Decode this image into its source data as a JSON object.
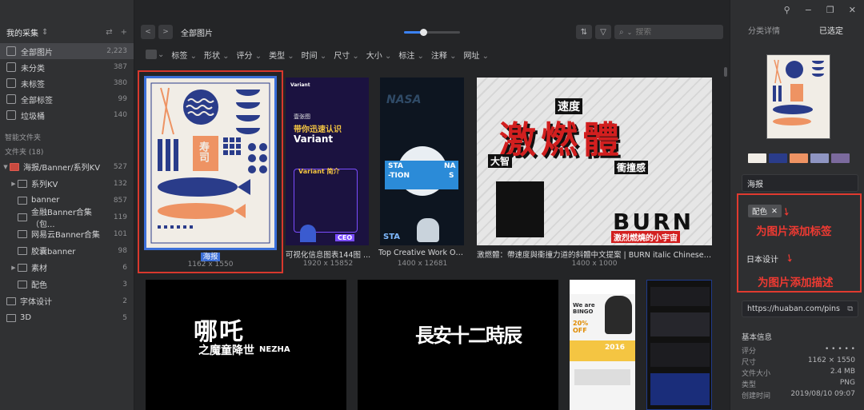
{
  "sidebar": {
    "library_label": "我的采集",
    "nav": [
      {
        "label": "全部图片",
        "count": "2,223"
      },
      {
        "label": "未分类",
        "count": "387"
      },
      {
        "label": "未标签",
        "count": "380"
      },
      {
        "label": "全部标签",
        "count": "99"
      },
      {
        "label": "垃圾桶",
        "count": "140"
      }
    ],
    "smart_folders_label": "智能文件夹",
    "folders_label": "文件夹 (18)",
    "folders": [
      {
        "label": "海报/Banner/系列KV",
        "count": "527"
      },
      {
        "label": "系列KV",
        "count": "132"
      },
      {
        "label": "banner",
        "count": "857"
      },
      {
        "label": "金融Banner合集（包...",
        "count": "119"
      },
      {
        "label": "网易云Banner合集",
        "count": "101"
      },
      {
        "label": "胶囊banner",
        "count": "98"
      },
      {
        "label": "素材",
        "count": "6"
      },
      {
        "label": "配色",
        "count": "3"
      },
      {
        "label": "字体设计",
        "count": "2"
      },
      {
        "label": "3D",
        "count": "5"
      }
    ]
  },
  "toolbar": {
    "breadcrumb": "全部图片",
    "search_placeholder": "搜索",
    "zoom_fraction": 0.35
  },
  "filters": [
    "标签",
    "形状",
    "评分",
    "类型",
    "时间",
    "尺寸",
    "大小",
    "标注",
    "注释",
    "网址"
  ],
  "grid": [
    {
      "caption": "海报",
      "dims": "1162 x 1550"
    },
    {
      "caption": "可视化信息图表144图 ...",
      "dims": "1920 x 15852"
    },
    {
      "caption": "Top Creative Work On...",
      "dims": "1400 x 12681"
    },
    {
      "caption": "激燃體：帶速度與衝撞力道的斜體中文提案 | BURN italic Chinese fon...",
      "dims": "1400 x 1000"
    }
  ],
  "thumb_text": {
    "variant_brand": "Variant",
    "variant_sub": "壹张图",
    "variant_h1": "带你迅速认识",
    "variant_h2": "Variant",
    "variant_h3": "Variant 简介",
    "variant_ceo": "CEO",
    "nasa": "NASA",
    "nasa_l1": "STA",
    "nasa_l2": "-TION",
    "nasa_l3": "NA",
    "nasa_l4": "S",
    "burn_big": "激燃體",
    "burn_small": "速度",
    "burn_en": "BURN",
    "burn_a": "大智",
    "burn_b": "衝撞感",
    "burn_c": "激烈燃燒的小宇宙",
    "nezha_title": "哪吒",
    "nezha_sub": "之魔童降世",
    "nezha_en": "NEZHA",
    "zhuang_title": "長安十二時辰",
    "bingo": "We are BINGO",
    "pct": "20% OFF",
    "year": "2016",
    "sushi": "寿司"
  },
  "panel": {
    "tab_details": "分类详情",
    "tab_selected": "已选定",
    "colors": [
      "#f1ede6",
      "#2a3c8a",
      "#ee9363",
      "#8f95c2",
      "#7b6a9d"
    ],
    "name": "海报",
    "tag": "配色",
    "annot_tag": "为图片添加标签",
    "description": "日本设计",
    "annot_desc": "为图片添加描述",
    "url": "https://huaban.com/pins",
    "info_title": "基本信息",
    "info": [
      {
        "k": "评分",
        "v": "• • • • •"
      },
      {
        "k": "尺寸",
        "v": "1162 × 1550"
      },
      {
        "k": "文件大小",
        "v": "2.4 MB"
      },
      {
        "k": "类型",
        "v": "PNG"
      },
      {
        "k": "创建时间",
        "v": "2019/08/10 09:07"
      }
    ]
  }
}
